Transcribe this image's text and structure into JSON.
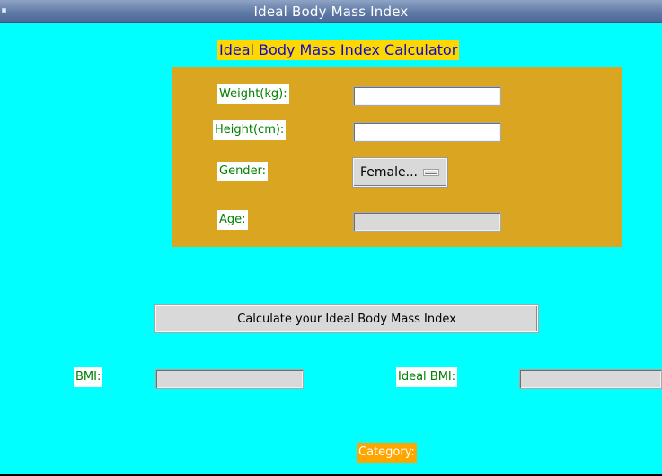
{
  "window": {
    "title": "Ideal Body Mass Index"
  },
  "header": {
    "title": "Ideal Body Mass Index Calculator"
  },
  "form": {
    "weight": {
      "label": "Weight(kg):",
      "value": ""
    },
    "height": {
      "label": "Height(cm):",
      "value": ""
    },
    "gender": {
      "label": "Gender:",
      "selected": "Female..."
    },
    "age": {
      "label": "Age:",
      "value": ""
    }
  },
  "actions": {
    "calculate_label": "Calculate your Ideal Body Mass Index"
  },
  "results": {
    "bmi": {
      "label": "BMI:",
      "value": ""
    },
    "ideal_bmi": {
      "label": "Ideal BMI:",
      "value": ""
    },
    "category": {
      "label": "Category:"
    }
  },
  "colors": {
    "background": "#00ffff",
    "panel": "#daa520",
    "header_bg": "#ffd700",
    "header_text": "#0b0bd0",
    "label_text": "#008000",
    "category_bg": "#ffa500"
  }
}
